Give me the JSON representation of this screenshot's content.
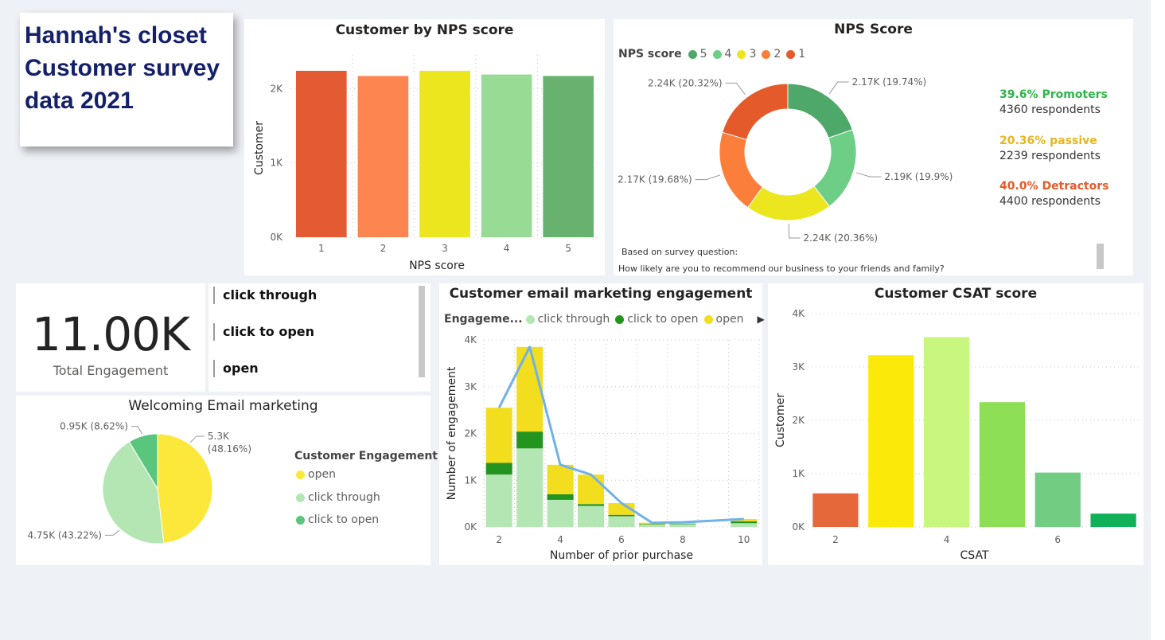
{
  "dashboard": {
    "title_lines": [
      "Hannah's closet",
      "Customer survey",
      "data 2021"
    ]
  },
  "nps_bar": {
    "title": "Customer by NPS score",
    "chart_data": {
      "type": "bar",
      "title": "Customer by NPS score",
      "xlabel": "NPS score",
      "ylabel": "Customer",
      "categories": [
        "1",
        "2",
        "3",
        "4",
        "5"
      ],
      "values": [
        2240,
        2170,
        2240,
        2190,
        2170
      ],
      "colors": [
        "#e35a33",
        "#fd8550",
        "#ebe61e",
        "#98db94",
        "#67b26f"
      ],
      "ylim": [
        0,
        2400
      ],
      "yticks": [
        "0K",
        "1K",
        "2K"
      ],
      "grid": "dotted"
    }
  },
  "nps_donut": {
    "title": "NPS Score",
    "legend_title": "NPS score",
    "legend": [
      {
        "label": "5",
        "color": "#4ea86a"
      },
      {
        "label": "4",
        "color": "#6ece86"
      },
      {
        "label": "3",
        "color": "#ebe61e"
      },
      {
        "label": "2",
        "color": "#fb7f3a"
      },
      {
        "label": "1",
        "color": "#e55a2b"
      }
    ],
    "chart_data": {
      "type": "pie",
      "slices": [
        {
          "label": "5",
          "value": 2170,
          "text": "2.17K (19.74%)",
          "color": "#4ea86a"
        },
        {
          "label": "4",
          "value": 2190,
          "text": "2.19K (19.9%)",
          "color": "#6ece86"
        },
        {
          "label": "3",
          "value": 2240,
          "text": "2.24K (20.36%)",
          "color": "#ebe61e"
        },
        {
          "label": "2",
          "value": 2170,
          "text": "2.17K (19.68%)",
          "color": "#fb7f3a"
        },
        {
          "label": "1",
          "value": 2240,
          "text": "2.24K (20.32%)",
          "color": "#e55a2b"
        }
      ]
    },
    "stats": [
      {
        "headline": "39.6% Promoters",
        "sub": "4360 respondents",
        "color": "#2fb44a"
      },
      {
        "headline": "20.36% passive",
        "sub": "2239 respondents",
        "color": "#e5b622"
      },
      {
        "headline": "40.0% Detractors",
        "sub": "4400 respondents",
        "color": "#e55a2b"
      }
    ],
    "note_1": "Based on survey question:",
    "note_2": "How likely are you to recommend our business  to your friends and family?"
  },
  "kpi": {
    "value": "11.00K",
    "label": "Total Engagement"
  },
  "slicer": {
    "items": [
      "click through",
      "click to open",
      "open"
    ]
  },
  "welcome_pie": {
    "title": "Welcoming Email marketing",
    "legend_title": "Customer Engagement",
    "legend": [
      {
        "label": "open",
        "color": "#fce83a"
      },
      {
        "label": "click through",
        "color": "#b4e6b4"
      },
      {
        "label": "click to open",
        "color": "#5ac57c"
      }
    ],
    "chart_data": {
      "type": "pie",
      "slices": [
        {
          "label": "open",
          "value": 5300,
          "text_1": "5.3K",
          "text_2": "(48.16%)",
          "color": "#fce83a"
        },
        {
          "label": "click through",
          "value": 4750,
          "text": "4.75K (43.22%)",
          "color": "#b4e6b4"
        },
        {
          "label": "click to open",
          "value": 950,
          "text": "0.95K (8.62%)",
          "color": "#5ac57c"
        }
      ]
    }
  },
  "email_engagement": {
    "title": "Customer email marketing engagement",
    "legend_title": "Engageme...",
    "legend": [
      {
        "label": "click through",
        "color": "#b4e6b4"
      },
      {
        "label": "click to open",
        "color": "#23951f"
      },
      {
        "label": "open",
        "color": "#f2dd1e"
      }
    ],
    "chart_data": {
      "type": "bar",
      "stacked": true,
      "xlabel": "Number of prior purchase",
      "ylabel": "Number of engagement",
      "x": [
        2,
        3,
        4,
        5,
        6,
        7,
        8,
        10
      ],
      "series": [
        {
          "name": "click through",
          "values": [
            1120,
            1680,
            580,
            450,
            230,
            50,
            60,
            80
          ]
        },
        {
          "name": "click to open",
          "values": [
            250,
            360,
            120,
            40,
            30,
            10,
            10,
            40
          ]
        },
        {
          "name": "open",
          "values": [
            1180,
            1810,
            630,
            630,
            250,
            30,
            30,
            50
          ]
        }
      ],
      "line": {
        "values": [
          2550,
          3850,
          1330,
          1120,
          510,
          90,
          100,
          170
        ],
        "color": "#6fb1e8"
      },
      "ylim": [
        0,
        4000
      ],
      "yticks": [
        "0K",
        "1K",
        "2K",
        "3K",
        "4K"
      ],
      "xticks": [
        "2",
        "4",
        "6",
        "8",
        "10"
      ],
      "grid": "dotted"
    }
  },
  "csat": {
    "title": "Customer CSAT score",
    "chart_data": {
      "type": "bar",
      "title": "Customer CSAT score",
      "xlabel": "CSAT",
      "ylabel": "Customer",
      "categories": [
        "2",
        "3",
        "4",
        "5",
        "6",
        "7"
      ],
      "values": [
        630,
        3220,
        3560,
        2340,
        1020,
        250
      ],
      "colors": [
        "#e5683a",
        "#fbe90a",
        "#c8f77f",
        "#8ddf55",
        "#72cc82",
        "#11b15a"
      ],
      "ylim": [
        0,
        4000
      ],
      "yticks": [
        "0K",
        "1K",
        "2K",
        "3K",
        "4K"
      ],
      "xticks": [
        "2",
        "4",
        "6"
      ],
      "grid": "dotted"
    }
  }
}
